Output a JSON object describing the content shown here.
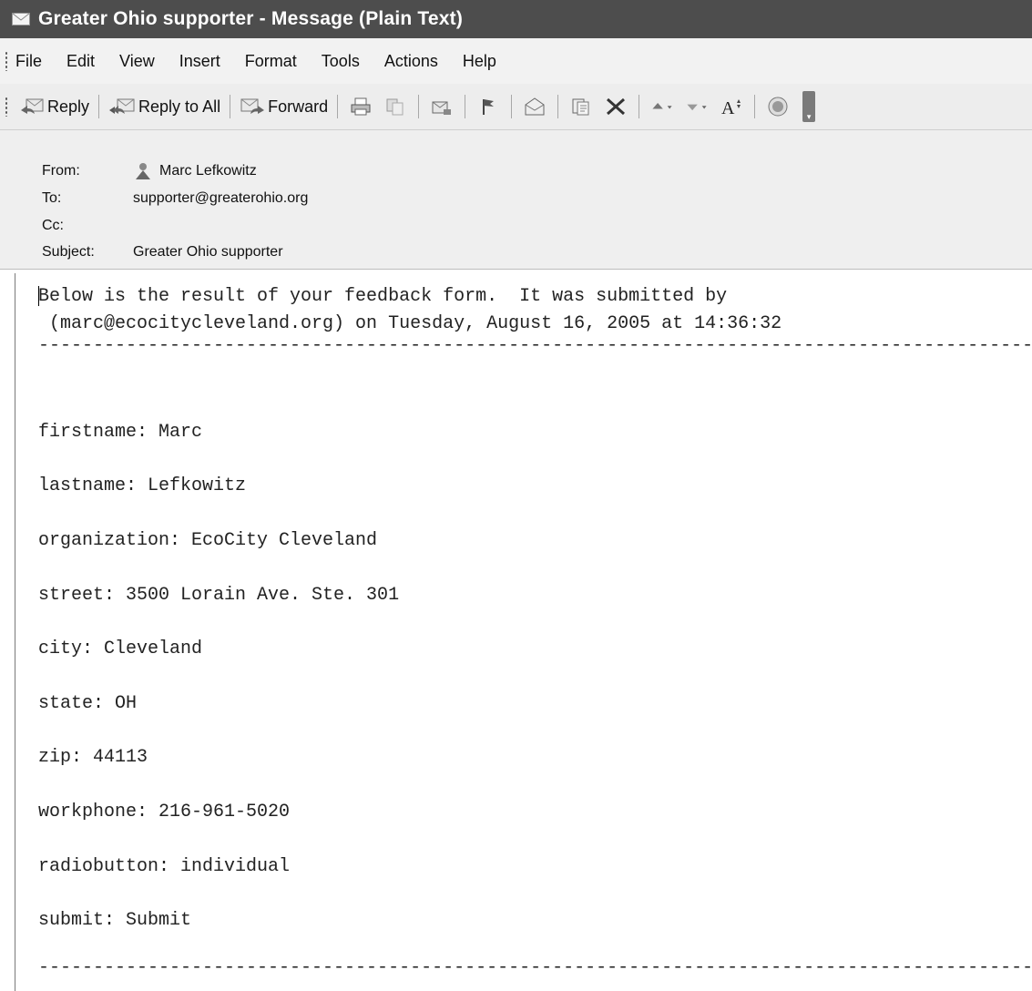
{
  "window": {
    "title": "Greater Ohio supporter - Message (Plain Text)"
  },
  "menu": [
    "File",
    "Edit",
    "View",
    "Insert",
    "Format",
    "Tools",
    "Actions",
    "Help"
  ],
  "toolbar": {
    "reply": "Reply",
    "reply_all": "Reply to All",
    "forward": "Forward",
    "icons": [
      "print-icon",
      "copy-icon",
      "move-to-folder-icon",
      "follow-up-flag-icon",
      "mark-unread-icon",
      "address-book-icon",
      "delete-icon",
      "previous-item-icon",
      "next-item-icon",
      "font-size-icon",
      "help-icon"
    ]
  },
  "header": {
    "from_label": "From:",
    "from_value": "Marc Lefkowitz",
    "to_label": "To:",
    "to_value": "supporter@greaterohio.org",
    "cc_label": "Cc:",
    "cc_value": "",
    "subject_label": "Subject:",
    "subject_value": "Greater Ohio supporter"
  },
  "message": {
    "intro_line1": "Below is the result of your feedback form.  It was submitted by",
    "intro_line2": " (marc@ecocitycleveland.org) on Tuesday, August 16, 2005 at 14:36:32",
    "separator": "-----------------------------------------------------------------------------------------------",
    "fields": [
      "firstname: Marc",
      "lastname: Lefkowitz",
      "organization: EcoCity Cleveland",
      "street: 3500 Lorain Ave. Ste. 301",
      "city: Cleveland",
      "state: OH",
      "zip: 44113",
      "workphone: 216-961-5020",
      "radiobutton: individual",
      "submit: Submit"
    ]
  }
}
